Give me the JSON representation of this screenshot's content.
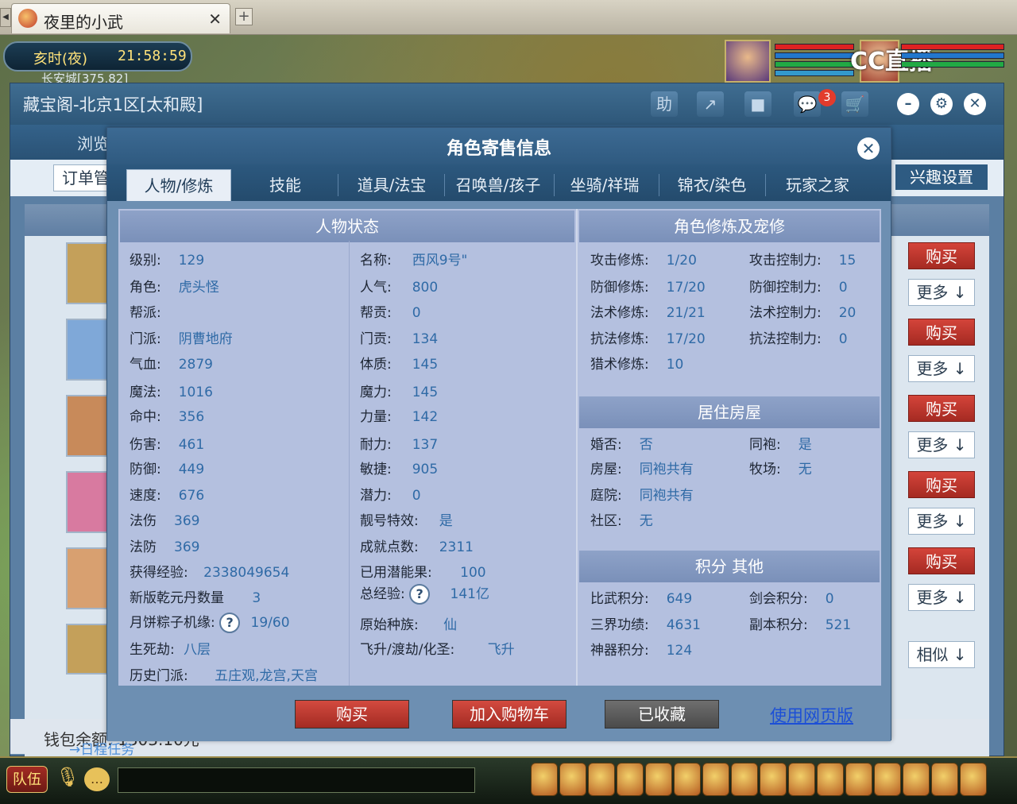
{
  "browser": {
    "tab_title": "夜里的小武",
    "tab_close": "✕",
    "tab_add": "+"
  },
  "game": {
    "time_label": "亥时(夜)",
    "time_value": "21:58:59",
    "location": "长安城[375,82]",
    "cc_logo": "CC直播"
  },
  "cbg": {
    "title": "藏宝阁-北京1区[太和殿]",
    "toolbar_icons": [
      "助",
      "↗",
      "■",
      "💬",
      "🛒"
    ],
    "message_badge": "3",
    "nav_browse": "浏览",
    "order_button": "订单管",
    "interest_button": "兴趣设置",
    "buy_label": "购买",
    "more_label": "更多",
    "similar_label": "相似",
    "wallet": "钱包余额: 1303.10元",
    "task_link": "→日程任务"
  },
  "modal": {
    "title": "角色寄售信息",
    "close": "✕",
    "tabs": [
      "人物/修炼",
      "技能",
      "道具/法宝",
      "召唤兽/孩子",
      "坐骑/祥瑞",
      "锦衣/染色",
      "玩家之家"
    ],
    "active_tab": "人物/修炼",
    "left_panel_title": "人物状态",
    "right_panel_title": "角色修炼及宠修",
    "house_panel_title": "居住房屋",
    "score_panel_title": "积分 其他",
    "status_col1": [
      {
        "label": "级别:",
        "value": "129"
      },
      {
        "label": "角色:",
        "value": "虎头怪"
      },
      {
        "label": "帮派:",
        "value": ""
      },
      {
        "label": "门派:",
        "value": "阴曹地府"
      },
      {
        "label": "气血:",
        "value": "2879"
      },
      {
        "label": "魔法:",
        "value": "1016"
      },
      {
        "label": "命中:",
        "value": "356"
      },
      {
        "label": "伤害:",
        "value": "461"
      },
      {
        "label": "防御:",
        "value": "449"
      },
      {
        "label": "速度:",
        "value": "676"
      },
      {
        "label": "法伤",
        "value": "369"
      },
      {
        "label": "法防",
        "value": "369"
      }
    ],
    "status_col2": [
      {
        "label": "名称:",
        "value": "西风9号\""
      },
      {
        "label": "人气:",
        "value": "800"
      },
      {
        "label": "帮贡:",
        "value": "0"
      },
      {
        "label": "门贡:",
        "value": "134"
      },
      {
        "label": "体质:",
        "value": "145"
      },
      {
        "label": "魔力:",
        "value": "145"
      },
      {
        "label": "力量:",
        "value": "142"
      },
      {
        "label": "耐力:",
        "value": "137"
      },
      {
        "label": "敏捷:",
        "value": "905"
      },
      {
        "label": "潜力:",
        "value": "0"
      },
      {
        "label": "靓号特效:",
        "value": "是"
      },
      {
        "label": "成就点数:",
        "value": "2311"
      }
    ],
    "extra_rows": [
      {
        "label": "获得经验:",
        "value": "2338049654"
      },
      {
        "label": "已用潜能果:",
        "value": "100"
      },
      {
        "label": "新版乾元丹数量",
        "value": "3"
      },
      {
        "label": "总经验:",
        "value": "141亿"
      },
      {
        "label": "月饼粽子机缘:",
        "value": "19/60"
      },
      {
        "label": "原始种族:",
        "value": "仙"
      },
      {
        "label": "生死劫:",
        "value": "八层"
      },
      {
        "label": "飞升/渡劫/化圣:",
        "value": "飞升"
      },
      {
        "label": "历史门派:",
        "value": "五庄观,龙宫,天宫"
      }
    ],
    "question_mark": "?",
    "cultivation": [
      {
        "label": "攻击修炼:",
        "value": "1/20",
        "label2": "攻击控制力:",
        "value2": "15"
      },
      {
        "label": "防御修炼:",
        "value": "17/20",
        "label2": "防御控制力:",
        "value2": "0"
      },
      {
        "label": "法术修炼:",
        "value": "21/21",
        "label2": "法术控制力:",
        "value2": "20"
      },
      {
        "label": "抗法修炼:",
        "value": "17/20",
        "label2": "抗法控制力:",
        "value2": "0"
      },
      {
        "label": "猎术修炼:",
        "value": "10",
        "label2": "",
        "value2": ""
      }
    ],
    "house": [
      {
        "label": "婚否:",
        "value": "否",
        "label2": "同袍:",
        "value2": "是"
      },
      {
        "label": "房屋:",
        "value": "同袍共有",
        "label2": "牧场:",
        "value2": "无"
      },
      {
        "label": "庭院:",
        "value": "同袍共有",
        "label2": "",
        "value2": ""
      },
      {
        "label": "社区:",
        "value": "无",
        "label2": "",
        "value2": ""
      }
    ],
    "scores": [
      {
        "label": "比武积分:",
        "value": "649",
        "label2": "剑会积分:",
        "value2": "0"
      },
      {
        "label": "三界功绩:",
        "value": "4631",
        "label2": "副本积分:",
        "value2": "521"
      },
      {
        "label": "神器积分:",
        "value": "124",
        "label2": "",
        "value2": ""
      }
    ],
    "footer": {
      "buy": "购买",
      "add_cart": "加入购物车",
      "favorited": "已收藏",
      "web_link": "使用网页版"
    }
  },
  "gamebar": {
    "team": "队伍"
  }
}
